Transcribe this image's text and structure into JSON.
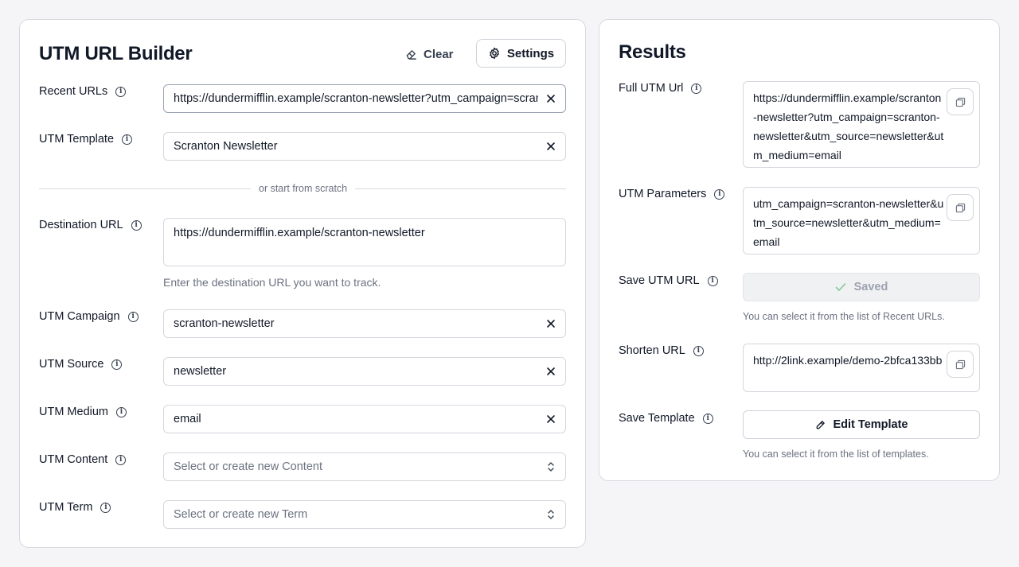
{
  "builder": {
    "title": "UTM URL Builder",
    "clear_label": "Clear",
    "settings_label": "Settings",
    "recent_urls": {
      "label": "Recent URLs",
      "value": "https://dundermifflin.example/scranton-newsletter?utm_campaign=scranton-newsletter&utm_source=newsletter&utm_medium=email"
    },
    "utm_template": {
      "label": "UTM Template",
      "value": "Scranton Newsletter"
    },
    "divider_text": "or start from scratch",
    "destination_url": {
      "label": "Destination URL",
      "value": "https://dundermifflin.example/scranton-newsletter",
      "helper": "Enter the destination URL you want to track."
    },
    "utm_campaign": {
      "label": "UTM Campaign",
      "value": "scranton-newsletter"
    },
    "utm_source": {
      "label": "UTM Source",
      "value": "newsletter"
    },
    "utm_medium": {
      "label": "UTM Medium",
      "value": "email"
    },
    "utm_content": {
      "label": "UTM Content",
      "placeholder": "Select or create new Content"
    },
    "utm_term": {
      "label": "UTM Term",
      "placeholder": "Select or create new Term"
    }
  },
  "results": {
    "title": "Results",
    "full_url": {
      "label": "Full UTM Url",
      "value": "https://dundermifflin.example/scranton-newsletter?utm_campaign=scranton-newsletter&utm_source=newsletter&utm_medium=email"
    },
    "parameters": {
      "label": "UTM Parameters",
      "value": "utm_campaign=scranton-newsletter&utm_source=newsletter&utm_medium=email"
    },
    "save_url": {
      "label": "Save UTM URL",
      "button": "Saved",
      "helper": "You can select it from the list of Recent URLs."
    },
    "shorten_url": {
      "label": "Shorten URL",
      "value": "http://2link.example/demo-2bfca133bb"
    },
    "save_template": {
      "label": "Save Template",
      "button": "Edit Template",
      "helper": "You can select it from the list of templates."
    }
  },
  "icons": {
    "info": "info-icon",
    "clear": "eraser-icon",
    "settings": "gear-icon",
    "close": "close-icon",
    "chevron": "chevron-updown-icon",
    "copy": "copy-icon",
    "check": "check-icon",
    "pencil": "pencil-icon"
  },
  "colors": {
    "check": "#86c79a"
  }
}
